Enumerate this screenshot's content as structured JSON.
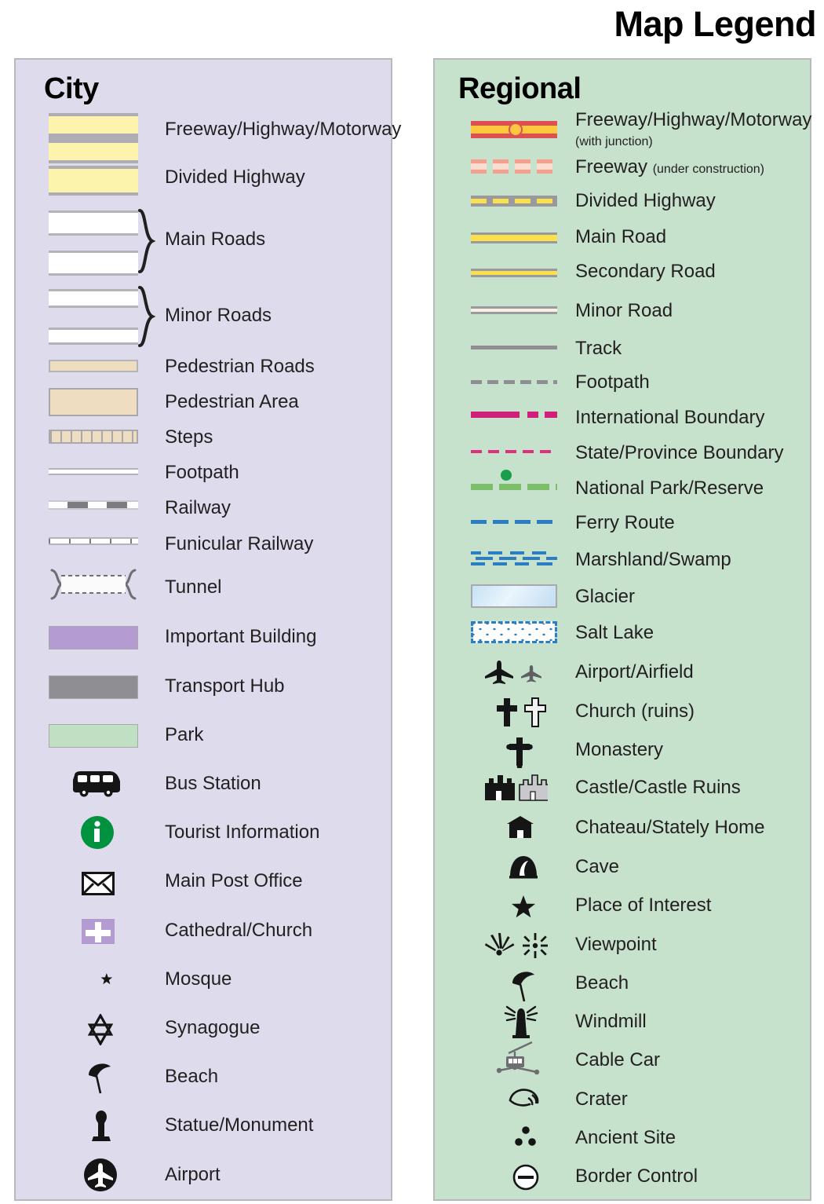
{
  "title": "Map Legend",
  "panels": {
    "city": {
      "heading": "City",
      "bg_color": "#dedcec",
      "items": [
        {
          "label": "Freeway/Highway/Motorway",
          "symbol": "freeway-divided-block"
        },
        {
          "label": "Divided Highway",
          "symbol": "divided-highway-block"
        },
        {
          "label": "Main Roads",
          "symbol": "main-roads-bracket"
        },
        {
          "label": "Minor Roads",
          "symbol": "minor-roads-bracket"
        },
        {
          "label": "Pedestrian Roads",
          "symbol": "pedestrian-road-line"
        },
        {
          "label": "Pedestrian Area",
          "symbol": "pedestrian-area-swatch"
        },
        {
          "label": "Steps",
          "symbol": "steps-line"
        },
        {
          "label": "Footpath",
          "symbol": "footpath-line"
        },
        {
          "label": "Railway",
          "symbol": "railway-line"
        },
        {
          "label": "Funicular Railway",
          "symbol": "funicular-railway-line"
        },
        {
          "label": "Tunnel",
          "symbol": "tunnel-bracket"
        },
        {
          "label": "Important Building",
          "symbol": "important-building-swatch"
        },
        {
          "label": "Transport Hub",
          "symbol": "transport-hub-swatch"
        },
        {
          "label": "Park",
          "symbol": "park-swatch"
        },
        {
          "label": "Bus Station",
          "symbol": "bus-icon"
        },
        {
          "label": "Tourist Information",
          "symbol": "information-icon"
        },
        {
          "label": "Main Post Office",
          "symbol": "envelope-icon"
        },
        {
          "label": "Cathedral/Church",
          "symbol": "church-cross-icon"
        },
        {
          "label": "Mosque",
          "symbol": "mosque-crescent-icon"
        },
        {
          "label": "Synagogue",
          "symbol": "star-of-david-icon"
        },
        {
          "label": "Beach",
          "symbol": "beach-umbrella-icon"
        },
        {
          "label": "Statue/Monument",
          "symbol": "statue-icon"
        },
        {
          "label": "Airport",
          "symbol": "airport-plane-icon"
        }
      ]
    },
    "regional": {
      "heading": "Regional",
      "bg_color": "#c6e2cc",
      "items": [
        {
          "label": "Freeway/Highway/Motorway",
          "sub": "(with junction)",
          "symbol": "freeway-junction-line"
        },
        {
          "label": "Freeway",
          "sub": "(under construction)",
          "symbol": "freeway-under-construction-line"
        },
        {
          "label": "Divided Highway",
          "symbol": "divided-highway-line"
        },
        {
          "label": "Main Road",
          "symbol": "main-road-line"
        },
        {
          "label": "Secondary Road",
          "symbol": "secondary-road-line"
        },
        {
          "label": "Minor Road",
          "symbol": "minor-road-line"
        },
        {
          "label": "Track",
          "symbol": "track-line"
        },
        {
          "label": "Footpath",
          "symbol": "footpath-dashed-line"
        },
        {
          "label": "International Boundary",
          "symbol": "international-boundary-line"
        },
        {
          "label": "State/Province Boundary",
          "symbol": "state-boundary-line"
        },
        {
          "label": "National Park/Reserve",
          "symbol": "national-park-line"
        },
        {
          "label": "Ferry Route",
          "symbol": "ferry-route-line"
        },
        {
          "label": "Marshland/Swamp",
          "symbol": "marshland-pattern"
        },
        {
          "label": "Glacier",
          "symbol": "glacier-swatch"
        },
        {
          "label": "Salt Lake",
          "symbol": "salt-lake-swatch"
        },
        {
          "label": "Airport/Airfield",
          "symbol": "airplane-icons"
        },
        {
          "label": "Church (ruins)",
          "symbol": "church-ruins-cross-icons"
        },
        {
          "label": "Monastery",
          "symbol": "monastery-cross-icon"
        },
        {
          "label": "Castle/Castle Ruins",
          "symbol": "castle-icons"
        },
        {
          "label": "Chateau/Stately Home",
          "symbol": "chateau-icon"
        },
        {
          "label": "Cave",
          "symbol": "cave-icon"
        },
        {
          "label": "Place of Interest",
          "symbol": "star-icon"
        },
        {
          "label": "Viewpoint",
          "symbol": "viewpoint-icons"
        },
        {
          "label": "Beach",
          "symbol": "beach-umbrella-icon"
        },
        {
          "label": "Windmill",
          "symbol": "windmill-icon"
        },
        {
          "label": "Cable Car",
          "symbol": "cable-car-icon"
        },
        {
          "label": "Crater",
          "symbol": "crater-icon"
        },
        {
          "label": "Ancient Site",
          "symbol": "ancient-site-dots-icon"
        },
        {
          "label": "Border Control",
          "symbol": "border-control-icon"
        }
      ]
    }
  },
  "colors": {
    "city_panel": "#dedcec",
    "regional_panel": "#c6e2cc",
    "panel_border": "#b9b9bd",
    "road_yellow": "#fcf3ad",
    "pedestrian_tan": "#eeddc0",
    "important_building": "#b49bd2",
    "transport_hub": "#8e8e93",
    "park_green": "#bfe0c3",
    "freeway_red": "#dd5050",
    "freeway_core": "#fdc740",
    "regional_yellow": "#f9e04c",
    "grey_casing": "#9a9a9e",
    "boundary_magenta": "#cf1f7a",
    "state_boundary": "#e0317f",
    "park_line_green": "#7cbe6a",
    "water_blue": "#2b7ec1",
    "tourist_green": "#00923f",
    "text": "#231f20"
  }
}
